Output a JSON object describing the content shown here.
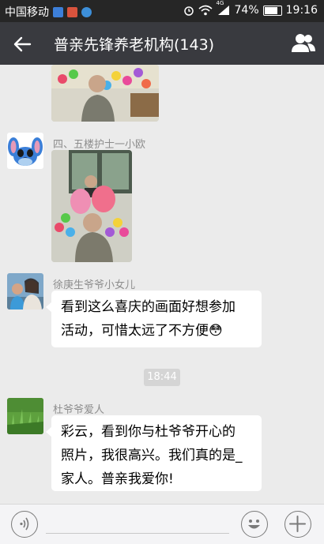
{
  "status_bar": {
    "carrier": "中国移动",
    "network": "4G",
    "battery": "74%",
    "battery_level": 0.74,
    "time": "19:16"
  },
  "header": {
    "title": "普亲先锋养老机构(143)",
    "back_icon": "back-arrow-icon",
    "members_icon": "group-members-icon"
  },
  "messages": [
    {
      "sender": "四、五楼护士一小欧",
      "type": "image",
      "content": "photo"
    },
    {
      "sender": "徐庚生爷爷小女儿",
      "type": "text",
      "lines": [
        "看到这么喜庆的画面好想参加",
        "活动，可惜太远了不方便"
      ],
      "emoji": "😳"
    },
    {
      "timestamp": "18:44"
    },
    {
      "sender": "杜爷爷爱人",
      "type": "text",
      "lines": [
        "彩云，看到你与杜爷爷开心的",
        "照片，我很高兴。我们真的是_",
        "家人。普亲我爱你!"
      ]
    }
  ],
  "input_bar": {
    "voice_icon": "voice-icon",
    "emoji_icon": "emoji-icon",
    "plus_icon": "plus-icon"
  },
  "colors": {
    "header_bg": "#393a3f",
    "status_bg": "#262626",
    "chat_bg": "#ebebeb",
    "bubble_bg": "#ffffff"
  }
}
